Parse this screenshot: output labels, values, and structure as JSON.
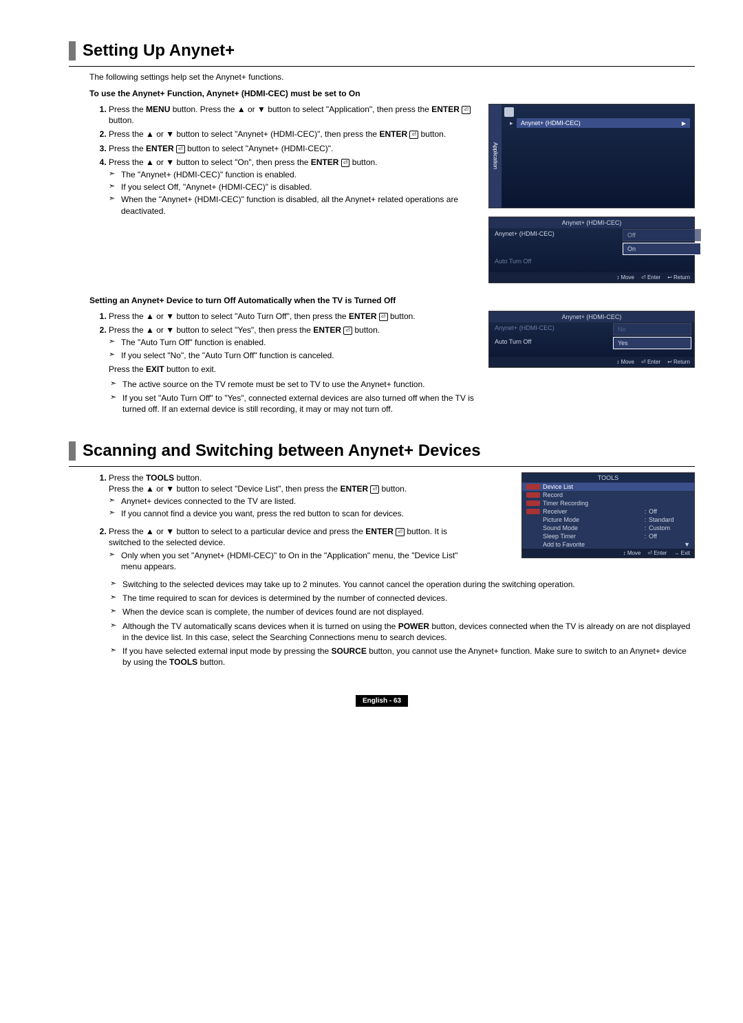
{
  "section1": {
    "title": "Setting Up Anynet+",
    "intro": "The following settings help set the Anynet+ functions.",
    "sub1": "To use the Anynet+ Function, Anynet+ (HDMI-CEC) must be set to On",
    "s1_1a": "Press the ",
    "s1_1b": "MENU",
    "s1_1c": " button. Press the ▲ or ▼ button to select \"Application\", then press the ",
    "s1_1d": "ENTER",
    "s1_1e": " button.",
    "s1_2a": "Press the ▲ or ▼ button to select \"Anynet+ (HDMI-CEC)\", then press the ",
    "s1_2b": "ENTER",
    "s1_2c": " button.",
    "s1_3a": "Press the ",
    "s1_3b": "ENTER",
    "s1_3c": " button to select \"Anynet+ (HDMI-CEC)\".",
    "s1_4a": "Press the ▲ or ▼ button to select \"On\", then press the ",
    "s1_4b": "ENTER",
    "s1_4c": " button.",
    "s1_b1": "The \"Anynet+ (HDMI-CEC)\" function is enabled.",
    "s1_b2": "If you select Off, \"Anynet+ (HDMI-CEC)\" is disabled.",
    "s1_b3": "When the \"Anynet+ (HDMI-CEC)\" function is disabled, all the Anynet+ related operations are deactivated.",
    "sub2": "Setting an Anynet+ Device to turn Off Automatically when the TV is Turned Off",
    "s2_1a": "Press the ▲ or ▼ button to select \"Auto Turn Off\", then press the ",
    "s2_1b": "ENTER",
    "s2_1c": " button.",
    "s2_2a": "Press the ▲ or ▼ button to select \"Yes\", then press the ",
    "s2_2b": "ENTER",
    "s2_2c": " button.",
    "s2_b1": "The \"Auto Turn Off\" function is enabled.",
    "s2_b2": "If you select \"No\", the \"Auto Turn Off\" function is canceled.",
    "s2_p1a": "Press the ",
    "s2_p1b": "EXIT",
    "s2_p1c": " button to exit.",
    "s2_tb1": "The active source on the TV remote must be set to TV to use the Anynet+ function.",
    "s2_tb2": "If you set \"Auto Turn Off\" to \"Yes\", connected external devices are also turned off when the TV is turned off. If an external device is still recording, it may or may not turn off."
  },
  "osdApp": {
    "sidebar": "Application",
    "highlight": "Anynet+ (HDMI-CEC)"
  },
  "osd1": {
    "title": "Anynet+ (HDMI-CEC)",
    "r1l": "Anynet+ (HDMI-CEC)",
    "r1v1": "Off",
    "r1v2": "On",
    "r2l": "Auto Turn Off",
    "f1": "↕ Move",
    "f2": "⏎ Enter",
    "f3": "↩ Return"
  },
  "osd2": {
    "title": "Anynet+ (HDMI-CEC)",
    "r1l": "Anynet+ (HDMI-CEC)",
    "r1v": "No",
    "r2l": "Auto Turn Off",
    "r2v": "Yes",
    "f1": "↕ Move",
    "f2": "⏎ Enter",
    "f3": "↩ Return"
  },
  "section2": {
    "title": "Scanning and Switching between Anynet+ Devices",
    "s1_a": "Press the ",
    "s1_b": "TOOLS",
    "s1_c": " button.",
    "s1_d": "Press the ▲ or ▼ button to select \"Device List\", then press the ",
    "s1_e": "ENTER",
    "s1_f": " button.",
    "s1_b1": "Anynet+ devices connected to the TV are listed.",
    "s1_b2": "If you cannot find a device you want, press the red button to scan for devices.",
    "s2_a": "Press the ▲ or ▼ button to select to a particular device and press the ",
    "s2_b": "ENTER",
    "s2_c": " button. It is switched to the selected device.",
    "s2_b1": "Only when you set \"Anynet+ (HDMI-CEC)\" to On in the \"Application\" menu, the \"Device List\" menu appears.",
    "tb1": "Switching to the selected devices may take up to 2 minutes. You cannot cancel the operation during the switching operation.",
    "tb2": "The time required to scan for devices is determined by the number of connected devices.",
    "tb3": "When the device scan is complete, the number of devices found are not displayed.",
    "tb4a": "Although the TV automatically scans devices when it is turned on using the ",
    "tb4b": "POWER",
    "tb4c": " button, devices connected when the TV is already on are not displayed in the device list. In this case, select the Searching Connections menu to search devices.",
    "tb5a": "If you have selected external input mode by pressing the ",
    "tb5b": "SOURCE",
    "tb5c": " button, you cannot use the Anynet+ function. Make sure to switch to an Anynet+ device by using the ",
    "tb5d": "TOOLS",
    "tb5e": " button."
  },
  "tools": {
    "title": "TOOLS",
    "r1": "Device List",
    "r2": "Record",
    "r3": "Timer Recording",
    "r4": "Receiver",
    "r4v": "Off",
    "r5": "Picture Mode",
    "r5v": "Standard",
    "r6": "Sound Mode",
    "r6v": "Custom",
    "r7": "Sleep Timer",
    "r7v": "Off",
    "r8": "Add to Favorite",
    "f1": "↕ Move",
    "f2": "⏎ Enter",
    "f3": "→ Exit"
  },
  "footer": "English - 63"
}
